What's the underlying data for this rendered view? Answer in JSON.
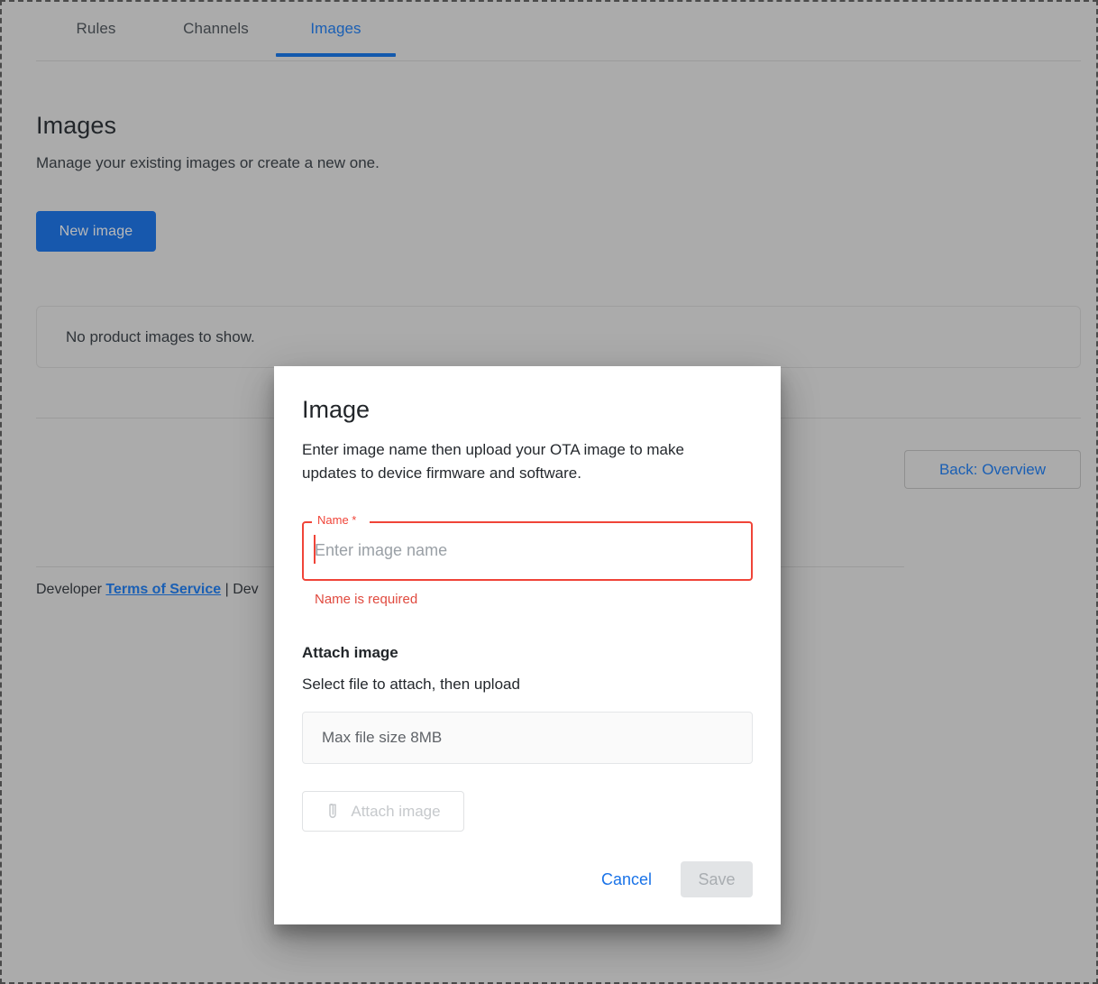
{
  "tabs": [
    {
      "label": "Rules",
      "active": false
    },
    {
      "label": "Channels",
      "active": false
    },
    {
      "label": "Images",
      "active": true
    }
  ],
  "page": {
    "title": "Images",
    "subtitle": "Manage your existing images or create a new one.",
    "new_image_label": "New image",
    "empty_state": "No product images to show.",
    "back_button_label": "Back: Overview"
  },
  "footer": {
    "prefix": "Developer",
    "link_label": "Terms of Service",
    "separator": "|",
    "suffix": "Dev"
  },
  "dialog": {
    "title": "Image",
    "description": "Enter image name then upload your OTA image to make updates to device firmware and software.",
    "name_label": "Name *",
    "name_value": "",
    "name_placeholder": "Enter image name",
    "name_error": "Name is required",
    "attach_heading": "Attach image",
    "attach_subtext": "Select file to attach, then upload",
    "file_placeholder": "Max file size 8MB",
    "attach_button_label": "Attach image",
    "cancel_label": "Cancel",
    "save_label": "Save"
  },
  "colors": {
    "accent_blue": "#1a5fb4",
    "link_blue": "#1a73e8",
    "primary_button": "#1758ad",
    "error_red": "#f04438",
    "page_background": "#ababab",
    "dialog_background": "#ffffff"
  },
  "icons": {
    "paperclip": "paperclip-icon"
  }
}
